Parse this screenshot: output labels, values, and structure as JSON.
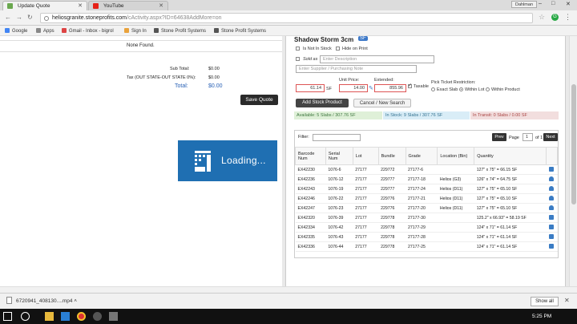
{
  "browser": {
    "tabs": [
      {
        "title": "Update Quote",
        "icon_color": "#6aa84f"
      },
      {
        "title": "YouTube",
        "icon_color": "#e62117"
      }
    ],
    "profile": "Dahlman",
    "url_host": "heliosgranite.stoneprofits.com",
    "url_path": "/cActivity.aspx?ID=64638AddMore=on",
    "bookmarks": [
      "Google",
      "Apps",
      "Gmail - Inbox - bigrol",
      "Sign In",
      "Stone Profit Systems",
      "Stone Profit Systems"
    ],
    "ext_label": "G"
  },
  "left": {
    "none_found": "None Found.",
    "subtotal_label": "Sub Total:",
    "subtotal_value": "$0.00",
    "tax_label": "Tax (OUT STATE-OUT STATE  0%):",
    "tax_value": "$0.00",
    "total_label": "Total:",
    "total_value": "$0.00",
    "save_button": "Save Quote",
    "loading_text": "Loading..."
  },
  "panel": {
    "title": "Shadow Storm 3cm",
    "title_badge": "SF",
    "not_in_stock": "Is Not In Stock",
    "hide_on_print": "Hide on Print",
    "sold_as": "Sold as",
    "description_placeholder": "Enter Description",
    "supplier_placeholder": "Enter Supplier / Purchasing Note",
    "qty_value": "61.14",
    "qty_unit": "SF",
    "unit_price_label": "Unit Price:",
    "unit_price_value": "14.00",
    "extended_label": "Extended:",
    "extended_value": "855.96",
    "taxable_label": "Taxable",
    "pick_label": "Pick Ticket Restriction:",
    "pick_options": [
      "Exact Slab",
      "Within Lot",
      "Within Product"
    ],
    "pick_selected": 1,
    "add_button": "Add Stock Product",
    "cancel_button": "Cancel / New Search",
    "available": "Available: 5 Slabs / 307.76 SF",
    "in_stock": "In Stock: 9 Slabs / 307.76 SF",
    "in_transit": "In Transit: 0 Slabs / 0.00 SF",
    "filter_label": "Filter:",
    "prev": "Prev",
    "page_label": "Page",
    "page_value": "1",
    "of_label": "of 1",
    "next": "Next",
    "columns": [
      "Barcode Num",
      "Serial Num",
      "Lot",
      "Bundle",
      "Grade",
      "Location (Bin)",
      "Quantity"
    ],
    "rows": [
      {
        "barcode": "EX42230",
        "serial": "1076-6",
        "lot": "27177",
        "bundle": "229772",
        "grade": "27177-6",
        "location": "",
        "quantity": "127\" x 75\" = 66.15 SF",
        "icon": "pick-icon"
      },
      {
        "barcode": "EX42236",
        "serial": "1076-12",
        "lot": "27177",
        "bundle": "229777",
        "grade": "27177-18",
        "location": "Helios (G3)",
        "quantity": "126\" x 74\" = 64.75 SF",
        "icon": "hand-icon"
      },
      {
        "barcode": "EX42243",
        "serial": "1076-19",
        "lot": "27177",
        "bundle": "229777",
        "grade": "27177-24",
        "location": "Helios (D11)",
        "quantity": "127\" x 75\" = 65.10 SF",
        "icon": "hand-icon"
      },
      {
        "barcode": "EX42246",
        "serial": "1076-22",
        "lot": "27177",
        "bundle": "229776",
        "grade": "27177-21",
        "location": "Helios (D11)",
        "quantity": "127\" x 75\" = 65.10 SF",
        "icon": "hand-icon"
      },
      {
        "barcode": "EX42247",
        "serial": "1076-23",
        "lot": "27177",
        "bundle": "229776",
        "grade": "27177-20",
        "location": "Helios (D11)",
        "quantity": "127\" x 75\" = 65.10 SF",
        "icon": "hand-icon"
      },
      {
        "barcode": "EX42320",
        "serial": "1076-39",
        "lot": "27177",
        "bundle": "229778",
        "grade": "27177-30",
        "location": "",
        "quantity": "125.2\" x 66.93\" = 58.19 SF",
        "icon": "pick-icon"
      },
      {
        "barcode": "EX42334",
        "serial": "1076-42",
        "lot": "27177",
        "bundle": "229778",
        "grade": "27177-29",
        "location": "",
        "quantity": "124\" x 71\" = 61.14 SF",
        "icon": "pick-icon"
      },
      {
        "barcode": "EX42335",
        "serial": "1076-43",
        "lot": "27177",
        "bundle": "229778",
        "grade": "27177-28",
        "location": "",
        "quantity": "124\" x 71\" = 61.14 SF",
        "icon": "pick-icon"
      },
      {
        "barcode": "EX42336",
        "serial": "1076-44",
        "lot": "27177",
        "bundle": "229778",
        "grade": "27177-25",
        "location": "",
        "quantity": "124\" x 71\" = 61.14 SF",
        "icon": "pick-icon"
      }
    ]
  },
  "downloads": {
    "file": "6720941_408130....mp4",
    "show_all": "Show all"
  },
  "taskbar": {
    "time": "5:25 PM"
  }
}
